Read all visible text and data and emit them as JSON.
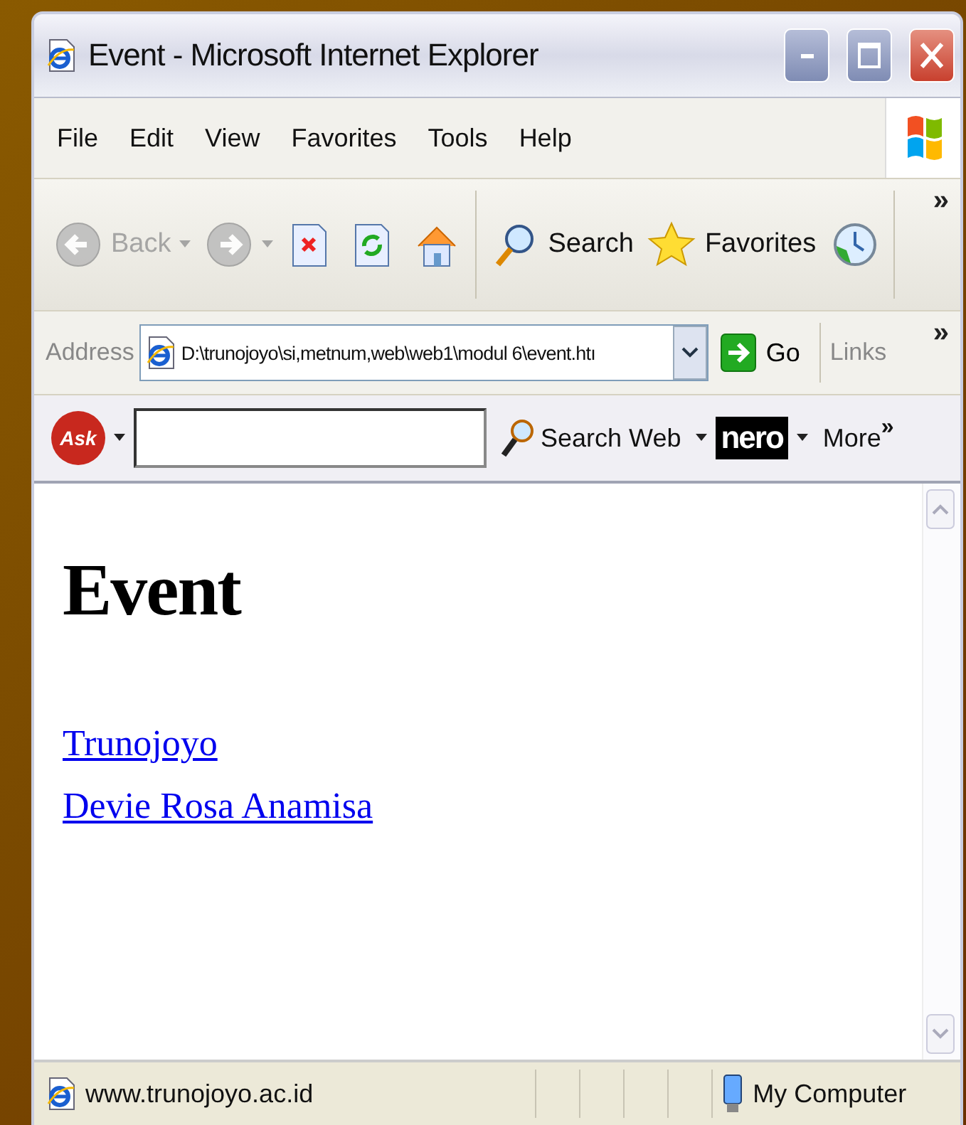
{
  "window": {
    "title": "Event - Microsoft Internet Explorer"
  },
  "menu": [
    "File",
    "Edit",
    "View",
    "Favorites",
    "Tools",
    "Help"
  ],
  "toolbar": [
    {
      "kind": "back",
      "label": "Back",
      "disabled": true
    },
    {
      "kind": "forward",
      "disabled": true
    },
    {
      "kind": "stop",
      "disabled": false
    },
    {
      "kind": "refresh",
      "disabled": false
    },
    {
      "kind": "home",
      "disabled": false
    },
    {
      "kind": "search",
      "label": "Search",
      "disabled": false
    },
    {
      "kind": "favorites",
      "label": "Favorites",
      "disabled": false
    },
    {
      "kind": "history",
      "disabled": false
    }
  ],
  "toolbar_more": "»",
  "address_bar": {
    "label": "Address",
    "value": "D:\\trunojoyo\\si,metnum,web\\web1\\modul 6\\event.htı",
    "go": "Go",
    "links": "Links",
    "more": "»"
  },
  "ask_bar": {
    "logo": "Ask",
    "search_button": "Search Web",
    "nero": "nero",
    "more": "More",
    "more_chevron": "»"
  },
  "page": {
    "heading": "Event",
    "links": [
      "Trunojoyo",
      "Devie Rosa Anamisa"
    ]
  },
  "status_bar": {
    "text": "www.trunojoyo.ac.id",
    "zone": "My Computer"
  }
}
